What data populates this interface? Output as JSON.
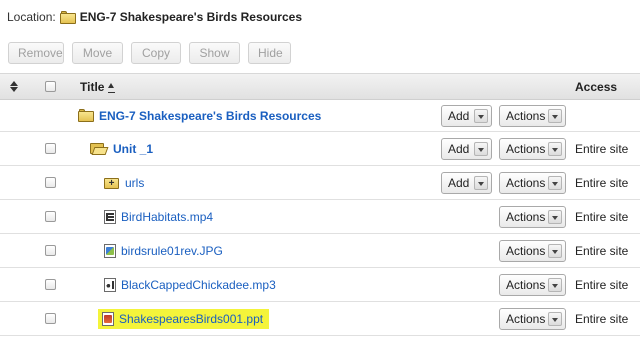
{
  "location": {
    "label": "Location:",
    "title": "ENG-7 Shakespeare's Birds Resources"
  },
  "toolbar": {
    "remove": "Remove",
    "move": "Move",
    "copy": "Copy",
    "show": "Show",
    "hide": "Hide"
  },
  "table": {
    "header": {
      "title": "Title",
      "access": "Access"
    },
    "rows": [
      {
        "title": "ENG-7 Shakespeare's Birds Resources",
        "type": "folder-closed",
        "add": "Add",
        "actions": "Actions",
        "access": ""
      },
      {
        "title": "Unit _1",
        "type": "folder-open",
        "add": "Add",
        "actions": "Actions",
        "access": "Entire site"
      },
      {
        "title": "urls",
        "type": "folder-plus",
        "add": "Add",
        "actions": "Actions",
        "access": "Entire site"
      },
      {
        "title": "BirdHabitats.mp4",
        "type": "video-file",
        "actions": "Actions",
        "access": "Entire site"
      },
      {
        "title": "birdsrule01rev.JPG",
        "type": "image-file",
        "actions": "Actions",
        "access": "Entire site"
      },
      {
        "title": "BlackCappedChickadee.mp3",
        "type": "audio-file",
        "actions": "Actions",
        "access": "Entire site"
      },
      {
        "title": "ShakespearesBirds001.ppt",
        "type": "ppt-file",
        "actions": "Actions",
        "access": "Entire site",
        "highlight_color": "#f4f43a"
      }
    ]
  },
  "colors": {
    "link": "#1a5fc0",
    "header_bg": "#e8e8e8",
    "highlight": "#f4f43a"
  }
}
